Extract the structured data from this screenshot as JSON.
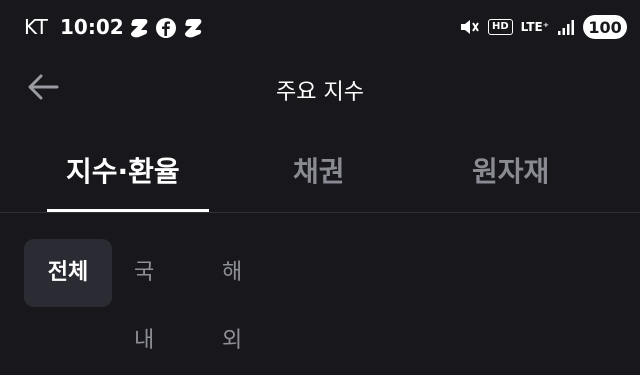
{
  "status_bar": {
    "carrier": "KT",
    "time": "10:02",
    "notification_icons": [
      "talk-icon",
      "facebook-icon",
      "talk-icon"
    ],
    "system_icons": [
      "mute-vibrate-icon",
      "hd-icon",
      "lte-plus-icon",
      "signal-icon"
    ],
    "hd_label": "HD",
    "lte_label": "LTE⁺",
    "battery": "100"
  },
  "header": {
    "back_icon": "arrow-left-icon",
    "title": "주요 지수"
  },
  "main_tabs": [
    {
      "label": "지수·환율",
      "active": true
    },
    {
      "label": "채권",
      "active": false
    },
    {
      "label": "원자재",
      "active": false
    }
  ],
  "sub_tabs": [
    {
      "label": "전체",
      "active": true
    },
    {
      "label": "국내",
      "active": false
    },
    {
      "label": "해외",
      "active": false
    }
  ],
  "colors": {
    "background": "#17171c",
    "text_primary": "#ffffff",
    "text_secondary": "#8a8a93",
    "chip_active": "#2b2c33",
    "divider": "#2f2f36"
  }
}
